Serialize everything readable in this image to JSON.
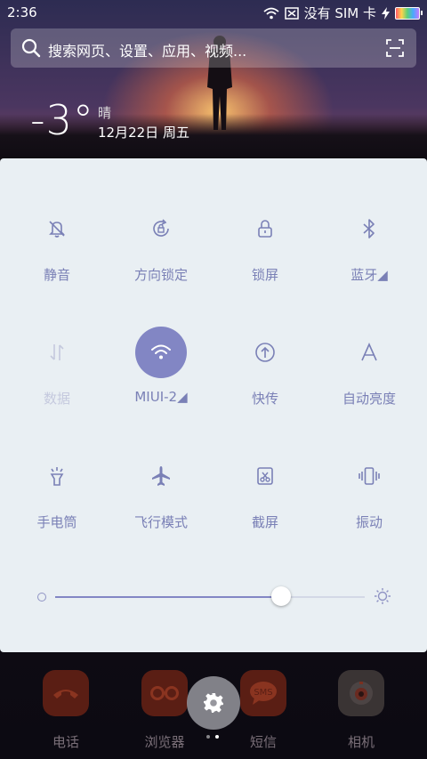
{
  "status_bar": {
    "time": "2:36",
    "carrier": "没有 SIM 卡"
  },
  "search": {
    "placeholder": "搜索网页、设置、应用、视频..."
  },
  "weather": {
    "temperature": "-3°",
    "condition": "晴",
    "date": "12月22日 周五"
  },
  "toggles": [
    {
      "label": "静音",
      "icon": "mute-bell-icon",
      "state": "off"
    },
    {
      "label": "方向锁定",
      "icon": "rotation-lock-icon",
      "state": "off"
    },
    {
      "label": "锁屏",
      "icon": "lock-icon",
      "state": "off"
    },
    {
      "label": "蓝牙◢",
      "icon": "bluetooth-icon",
      "state": "off"
    },
    {
      "label": "数据",
      "icon": "mobile-data-icon",
      "state": "disabled"
    },
    {
      "label": "MIUI-2◢",
      "icon": "wifi-icon",
      "state": "on"
    },
    {
      "label": "快传",
      "icon": "transfer-icon",
      "state": "off"
    },
    {
      "label": "自动亮度",
      "icon": "auto-brightness-icon",
      "state": "off"
    },
    {
      "label": "手电筒",
      "icon": "flashlight-icon",
      "state": "off"
    },
    {
      "label": "飞行模式",
      "icon": "airplane-icon",
      "state": "off"
    },
    {
      "label": "截屏",
      "icon": "screenshot-icon",
      "state": "off"
    },
    {
      "label": "振动",
      "icon": "vibrate-icon",
      "state": "off"
    }
  ],
  "brightness": {
    "level": 0.73
  },
  "dock": [
    {
      "label": "电话",
      "icon": "phone-icon",
      "color": "#5a1e14"
    },
    {
      "label": "浏览器",
      "icon": "browser-icon",
      "color": "#5a1e14"
    },
    {
      "label": "短信",
      "icon": "sms-icon",
      "color": "#5a1e14"
    },
    {
      "label": "相机",
      "icon": "camera-icon",
      "color": "#3a3434"
    }
  ],
  "colors": {
    "accent": "#8286c4",
    "panel": "#e9eff3",
    "label": "#7a80b6"
  }
}
